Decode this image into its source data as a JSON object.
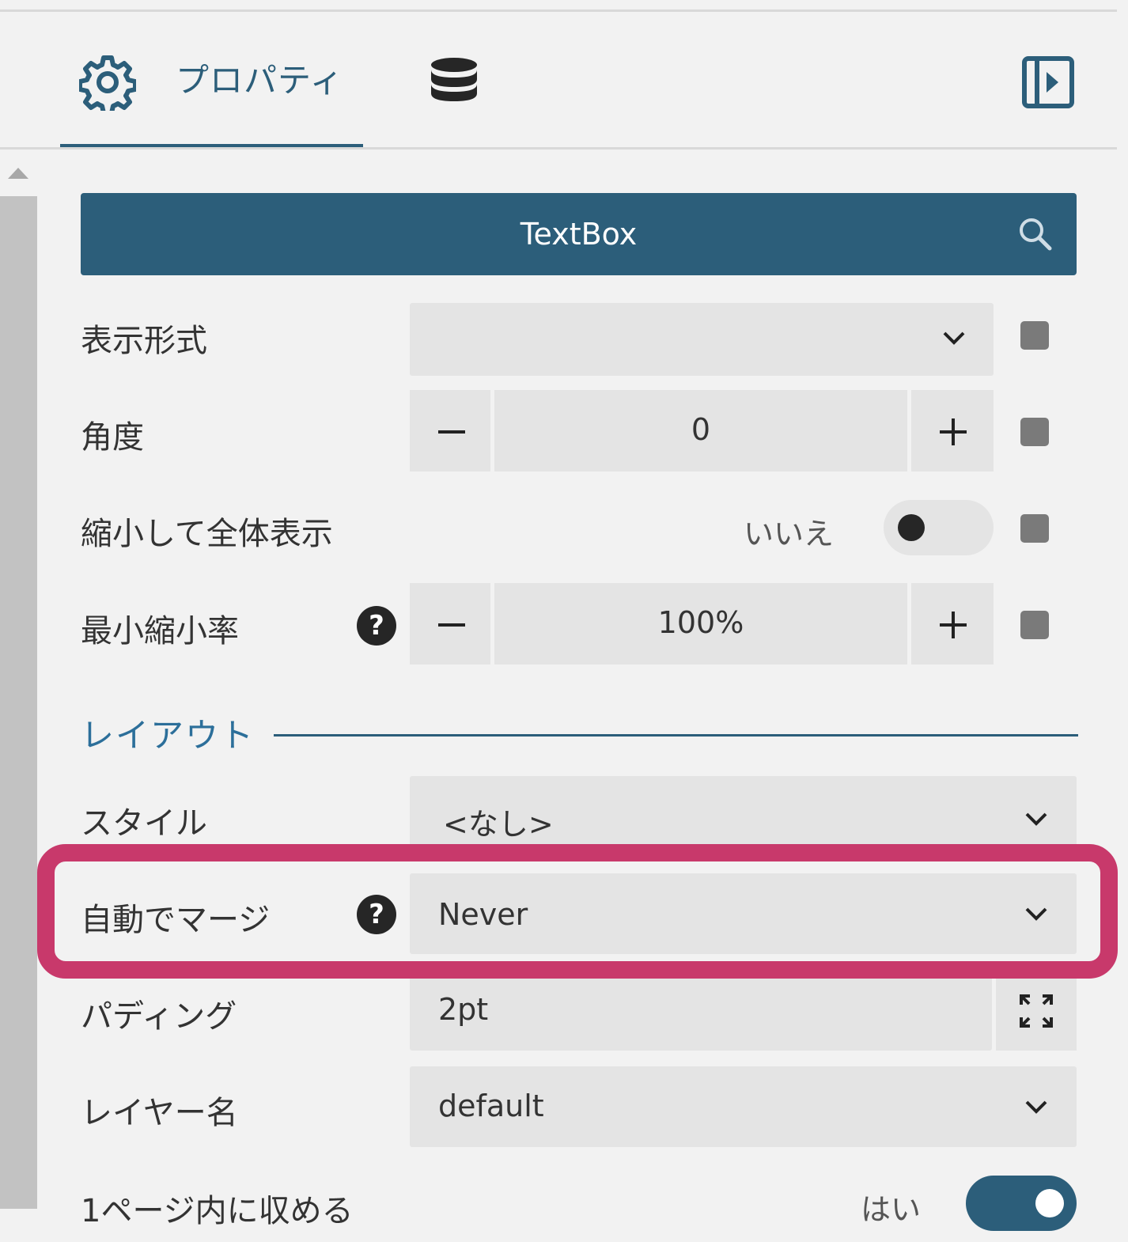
{
  "tabs": [
    {
      "label": "プロパティ",
      "icon": "gear-icon",
      "active": true
    },
    {
      "icon": "database-icon",
      "active": false
    }
  ],
  "panel_toggle_icon": "panel-collapse-icon",
  "header": {
    "title": "TextBox",
    "search_icon": "search-icon"
  },
  "properties": {
    "display_format": {
      "label": "表示形式",
      "value": ""
    },
    "angle": {
      "label": "角度",
      "value": "0"
    },
    "shrink_to_fit": {
      "label": "縮小して全体表示",
      "state_text": "いいえ",
      "on": false
    },
    "min_shrink_ratio": {
      "label": "最小縮小率",
      "value": "100%"
    }
  },
  "layout_section": {
    "title": "レイアウト",
    "style": {
      "label": "スタイル",
      "value": "<なし>"
    },
    "auto_merge": {
      "label": "自動でマージ",
      "value": "Never"
    },
    "padding": {
      "label": "パディング",
      "value": "2pt"
    },
    "layer_name": {
      "label": "レイヤー名",
      "value": "default"
    },
    "keep_on_one_page": {
      "label": "1ページ内に収める",
      "state_text": "はい",
      "on": true
    }
  },
  "colors": {
    "accent": "#2c5e7a",
    "highlight": "#c8396b"
  }
}
